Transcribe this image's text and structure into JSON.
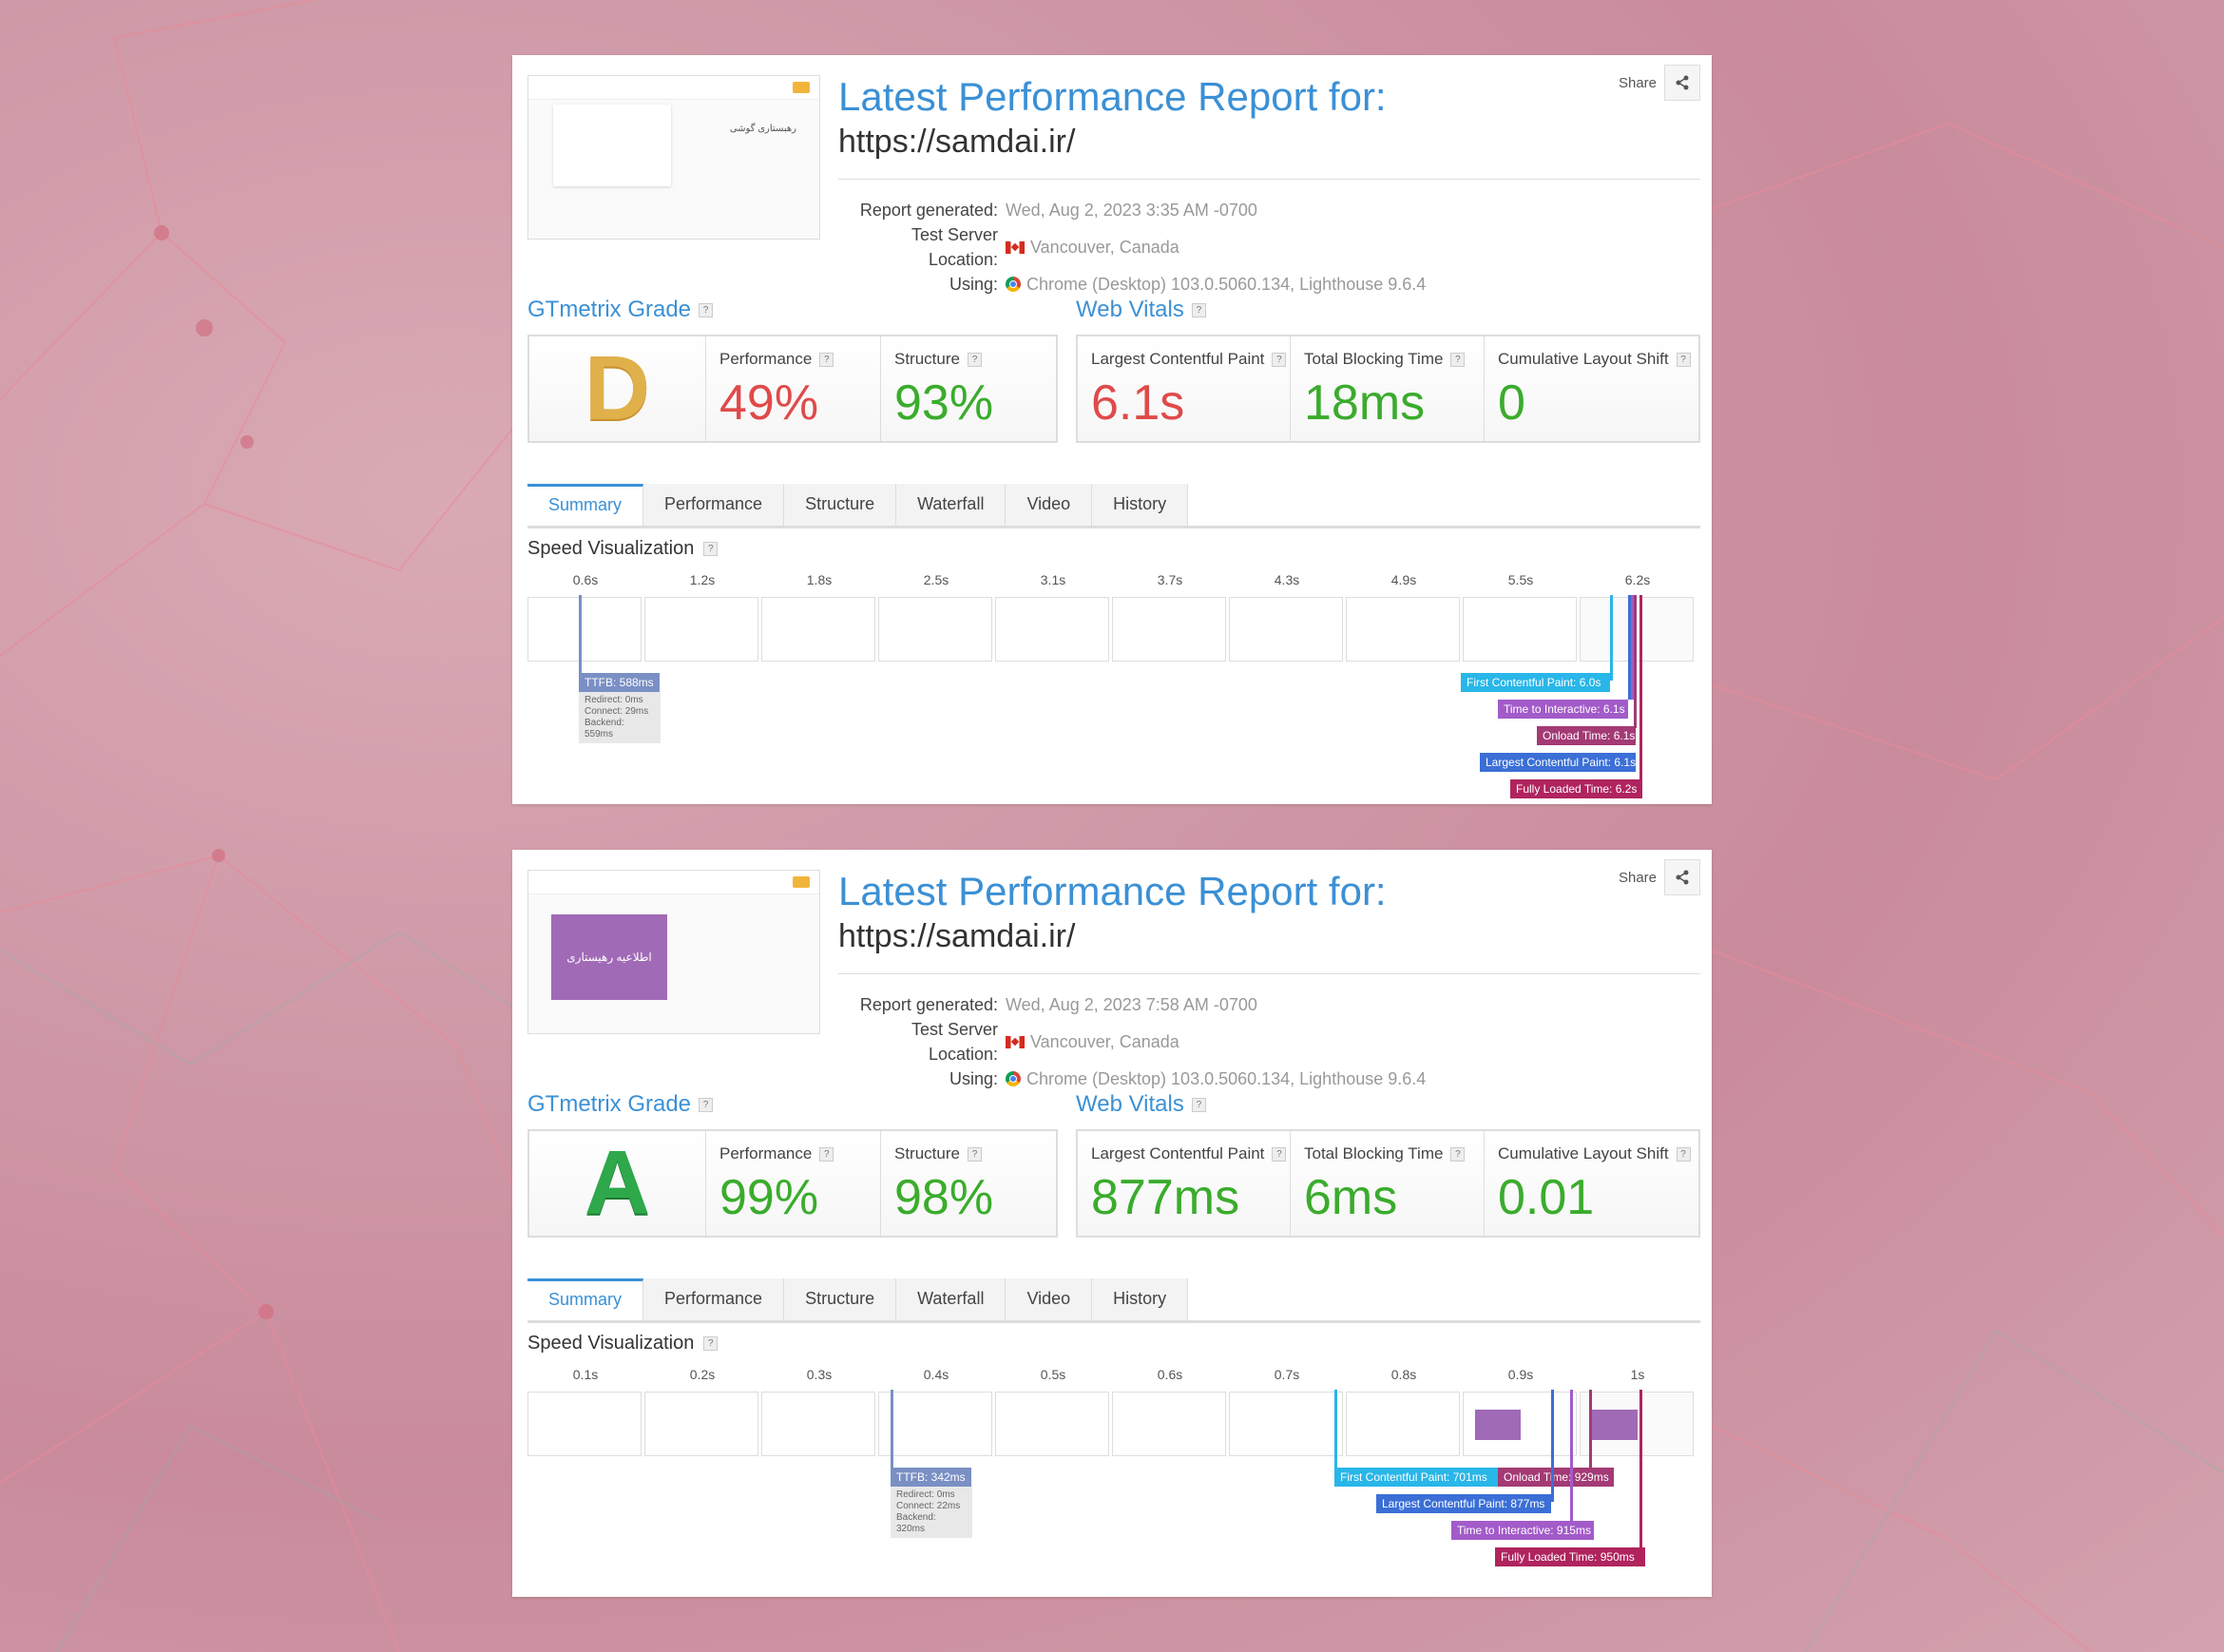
{
  "reports": [
    {
      "share_label": "Share",
      "title": "Latest Performance Report for:",
      "url": "https://samdai.ir/",
      "meta": {
        "report_generated_label": "Report generated:",
        "report_generated": "Wed, Aug 2, 2023 3:35 AM -0700",
        "server_label": "Test Server Location:",
        "server": "Vancouver, Canada",
        "using_label": "Using:",
        "using": "Chrome (Desktop) 103.0.5060.134, Lighthouse 9.6.4"
      },
      "grade_title": "GTmetrix Grade",
      "grade": "D",
      "grade_color": "#e0b04a",
      "performance_label": "Performance",
      "performance": "49%",
      "performance_color": "#e04a4a",
      "structure_label": "Structure",
      "structure": "93%",
      "structure_color": "#3aac2c",
      "vitals_title": "Web Vitals",
      "lcp_label": "Largest Contentful Paint",
      "lcp": "6.1s",
      "lcp_color": "#e04a4a",
      "tbt_label": "Total Blocking Time",
      "tbt": "18ms",
      "tbt_color": "#3aac2c",
      "cls_label": "Cumulative Layout Shift",
      "cls": "0",
      "cls_color": "#3aac2c",
      "tabs": [
        "Summary",
        "Performance",
        "Structure",
        "Waterfall",
        "Video",
        "History"
      ],
      "speed_title": "Speed Visualization",
      "ticks": [
        "0.6s",
        "1.2s",
        "1.8s",
        "2.5s",
        "3.1s",
        "3.7s",
        "4.3s",
        "4.9s",
        "5.5s",
        "6.2s"
      ],
      "thumb_heading": "رهبستاری گوشی",
      "ttfb_label": "TTFB: 588ms",
      "ttfb_detail": [
        "Redirect: 0ms",
        "Connect: 29ms",
        "Backend: 559ms"
      ],
      "markers": [
        {
          "label": "First Contentful Paint: 6.0s",
          "color": "#29b6e8"
        },
        {
          "label": "Time to Interactive: 6.1s",
          "color": "#a25bc9"
        },
        {
          "label": "Onload Time: 6.1s",
          "color": "#a33a75"
        },
        {
          "label": "Largest Contentful Paint: 6.1s",
          "color": "#3b6fd6"
        },
        {
          "label": "Fully Loaded Time: 6.2s",
          "color": "#b0245e"
        }
      ]
    },
    {
      "share_label": "Share",
      "title": "Latest Performance Report for:",
      "url": "https://samdai.ir/",
      "meta": {
        "report_generated_label": "Report generated:",
        "report_generated": "Wed, Aug 2, 2023 7:58 AM -0700",
        "server_label": "Test Server Location:",
        "server": "Vancouver, Canada",
        "using_label": "Using:",
        "using": "Chrome (Desktop) 103.0.5060.134, Lighthouse 9.6.4"
      },
      "grade_title": "GTmetrix Grade",
      "grade": "A",
      "grade_color": "#2ea84a",
      "performance_label": "Performance",
      "performance": "99%",
      "performance_color": "#3aac2c",
      "structure_label": "Structure",
      "structure": "98%",
      "structure_color": "#3aac2c",
      "vitals_title": "Web Vitals",
      "lcp_label": "Largest Contentful Paint",
      "lcp": "877ms",
      "lcp_color": "#3aac2c",
      "tbt_label": "Total Blocking Time",
      "tbt": "6ms",
      "tbt_color": "#3aac2c",
      "cls_label": "Cumulative Layout Shift",
      "cls": "0.01",
      "cls_color": "#3aac2c",
      "tabs": [
        "Summary",
        "Performance",
        "Structure",
        "Waterfall",
        "Video",
        "History"
      ],
      "speed_title": "Speed Visualization",
      "ticks": [
        "0.1s",
        "0.2s",
        "0.3s",
        "0.4s",
        "0.5s",
        "0.6s",
        "0.7s",
        "0.8s",
        "0.9s",
        "1s"
      ],
      "thumb_banner": "اطلاعیه رهیستاری",
      "ttfb_label": "TTFB: 342ms",
      "ttfb_detail": [
        "Redirect: 0ms",
        "Connect: 22ms",
        "Backend: 320ms"
      ],
      "markers": [
        {
          "label": "First Contentful Paint: 701ms",
          "color": "#29b6e8"
        },
        {
          "label": "Onload Time: 929ms",
          "color": "#a33a75"
        },
        {
          "label": "Largest Contentful Paint: 877ms",
          "color": "#3b6fd6"
        },
        {
          "label": "Time to Interactive: 915ms",
          "color": "#a25bc9"
        },
        {
          "label": "Fully Loaded Time: 950ms",
          "color": "#b0245e"
        }
      ]
    }
  ]
}
